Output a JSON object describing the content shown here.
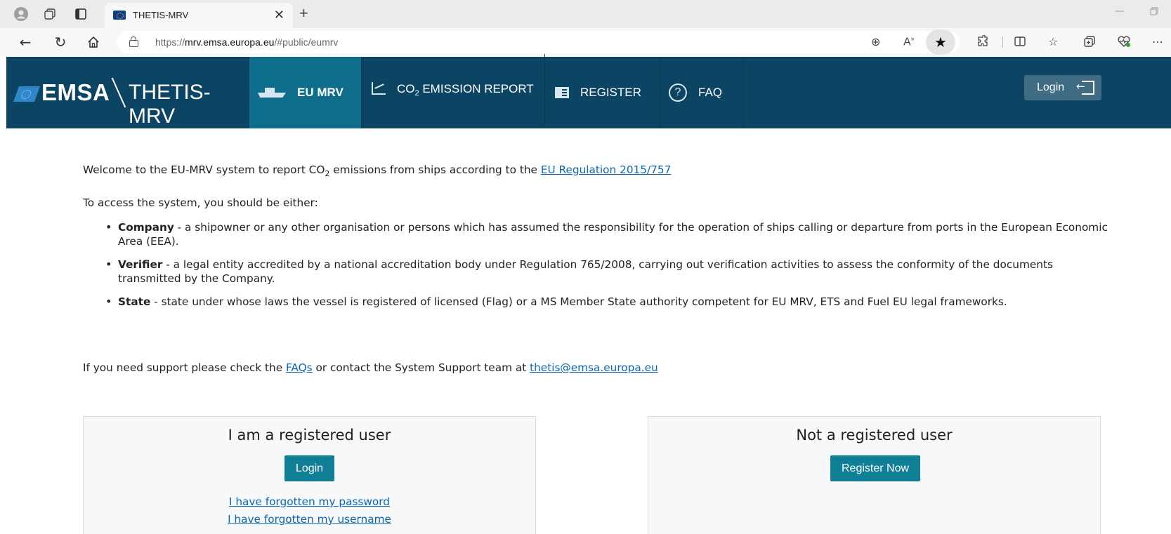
{
  "browser": {
    "tab_title": "THETIS-MRV",
    "url_prefix": "https://",
    "url_host": "mrv.emsa.europa.eu",
    "url_path": "/#public/eumrv"
  },
  "header": {
    "logo_emsa": "EMSA",
    "logo_app": "THETIS-MRV",
    "nav": {
      "eu_mrv": "EU MRV",
      "co2_prefix": "CO",
      "co2_sub": "2",
      "co2_suffix": " EMISSION REPORT",
      "register": "REGISTER",
      "faq": "FAQ"
    },
    "login_label": "Login",
    "colors": {
      "header_bg": "#0c4563",
      "active_nav_bg": "#0e6e8c"
    }
  },
  "content": {
    "welcome_pre": "Welcome to the EU-MRV system to report CO",
    "welcome_sub": "2",
    "welcome_post": " emissions from ships according to the ",
    "regulation_link": "EU Regulation 2015/757",
    "access_text": "To access the system, you should be either:",
    "roles": [
      {
        "name": "Company",
        "desc": " - a shipowner or any other organisation or persons which has assumed the responsibility for the operation of ships calling or departure from ports in the European Economic Area (EEA)."
      },
      {
        "name": "Verifier",
        "desc": " - a legal entity accredited by a national accreditation body under Regulation 765/2008, carrying out verification activities to assess the conformity of the documents transmitted by the Company."
      },
      {
        "name": "State",
        "desc": " - state under whose laws the vessel is registered of licensed (Flag) or a MS Member State authority competent for EU MRV, ETS and Fuel EU legal frameworks."
      }
    ],
    "support_pre": "If you need support please check the ",
    "support_faq_link": "FAQs",
    "support_mid": " or contact the System Support team at ",
    "support_email": "thetis@emsa.europa.eu"
  },
  "registered_card": {
    "title": "I am a registered user",
    "button": "Login",
    "forgot_password": "I have forgotten my password",
    "forgot_username": "I have forgotten my username"
  },
  "unregistered_card": {
    "title": "Not a registered user",
    "button": "Register Now"
  },
  "colors": {
    "link": "#0b66b6",
    "button": "#0f7f96"
  }
}
